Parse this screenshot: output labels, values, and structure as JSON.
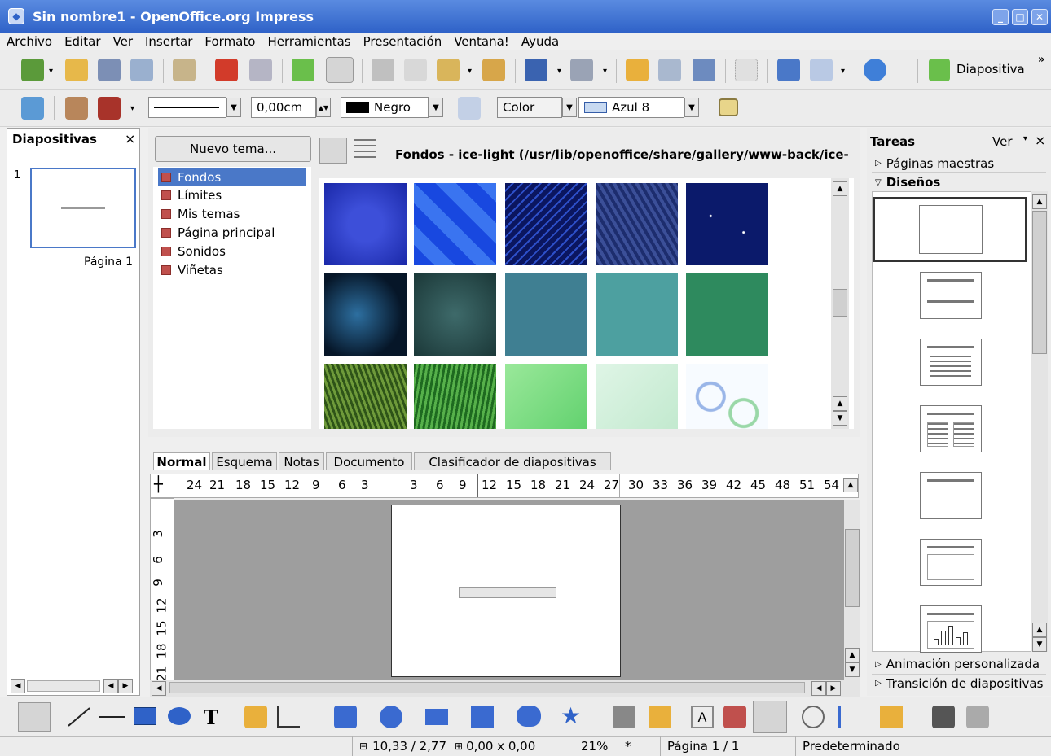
{
  "window": {
    "title": "Sin nombre1 - OpenOffice.org Impress"
  },
  "menu": [
    "Archivo",
    "Editar",
    "Ver",
    "Insertar",
    "Formato",
    "Herramientas",
    "Presentación",
    "Ventana!",
    "Ayuda"
  ],
  "toolbar1": {
    "slide_label": "Diapositiva",
    "overflow": "»"
  },
  "toolbar2": {
    "linewidth_value": "0,00cm",
    "linecolor": "Negro",
    "fillstyle": "Color",
    "fillcolor": "Azul 8"
  },
  "slides_panel": {
    "title": "Diapositivas",
    "close": "×",
    "slide_number": "1",
    "slide_label": "Página 1"
  },
  "gallery": {
    "new_theme": "Nuevo tema...",
    "themes": [
      "Fondos",
      "Límites",
      "Mis temas",
      "Página principal",
      "Sonidos",
      "Viñetas"
    ],
    "title": "Fondos - ice-light (/usr/lib/openoffice/share/gallery/www-back/ice-"
  },
  "tabs": [
    "Normal",
    "Esquema",
    "Notas",
    "Documento",
    "Clasificador de diapositivas"
  ],
  "ruler": {
    "h": [
      "24",
      "21",
      "18",
      "15",
      "12",
      "9",
      "6",
      "3",
      "3",
      "6",
      "9",
      "12",
      "15",
      "18",
      "21",
      "24",
      "27",
      "30",
      "33",
      "36",
      "39",
      "42",
      "45",
      "48",
      "51",
      "54"
    ],
    "v": [
      "3",
      "6",
      "9",
      "12",
      "15",
      "18",
      "21"
    ]
  },
  "tasks": {
    "title": "Tareas",
    "view": "Ver",
    "close": "×",
    "sections": [
      "Páginas maestras",
      "Diseños",
      "Animación personalizada",
      "Transición de diapositivas"
    ]
  },
  "status": {
    "position": "10,33 / 2,77",
    "size": "0,00 x 0,00",
    "zoom": "21%",
    "modified": "*",
    "page": "Página 1 / 1",
    "style": "Predeterminado"
  },
  "colors": {
    "title_top": "#5a8be0",
    "title_bottom": "#2f62c8",
    "selection": "#4a78c8"
  }
}
